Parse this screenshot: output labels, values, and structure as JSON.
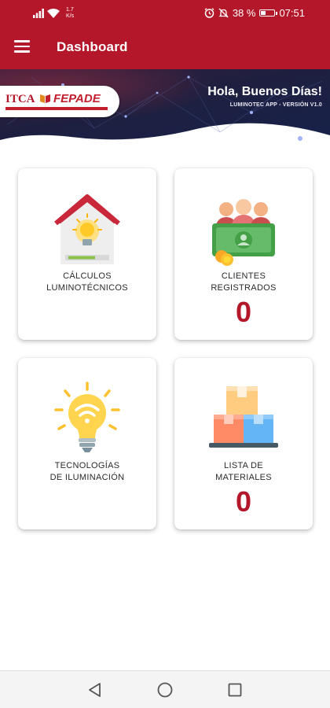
{
  "status_bar": {
    "speed_value": "1.7",
    "speed_unit": "K/s",
    "battery_percent": "38 %",
    "battery_level": 0.38,
    "time": "07:51"
  },
  "app_bar": {
    "title": "Dashboard",
    "menu_icon": "hamburger-menu-icon",
    "color": "#b5172a"
  },
  "banner": {
    "logo_text_1": "ITCA",
    "logo_text_2": "FEPADE",
    "greeting": "Hola, Buenos Días!",
    "version": "LUMINOTEC APP - VERSIÓN V1.0"
  },
  "cards": [
    {
      "line1": "CÁLCULOS",
      "line2": "LUMINOTÉCNICOS",
      "count": null,
      "icon": "house-lightbulb-icon"
    },
    {
      "line1": "CLIENTES",
      "line2": "REGISTRADOS",
      "count": "0",
      "icon": "clients-money-icon"
    },
    {
      "line1": "TECNOLOGÍAS",
      "line2": "DE ILUMINACIÓN",
      "count": null,
      "icon": "smart-lightbulb-icon"
    },
    {
      "line1": "LISTA DE",
      "line2": "MATERIALES",
      "count": "0",
      "icon": "boxes-icon"
    }
  ],
  "nav_bar": {
    "back_icon": "back-triangle-icon",
    "home_icon": "home-circle-icon",
    "recents_icon": "recents-square-icon"
  },
  "colors": {
    "accent": "#b5172a",
    "banner_dark": "#1e1f3f"
  }
}
